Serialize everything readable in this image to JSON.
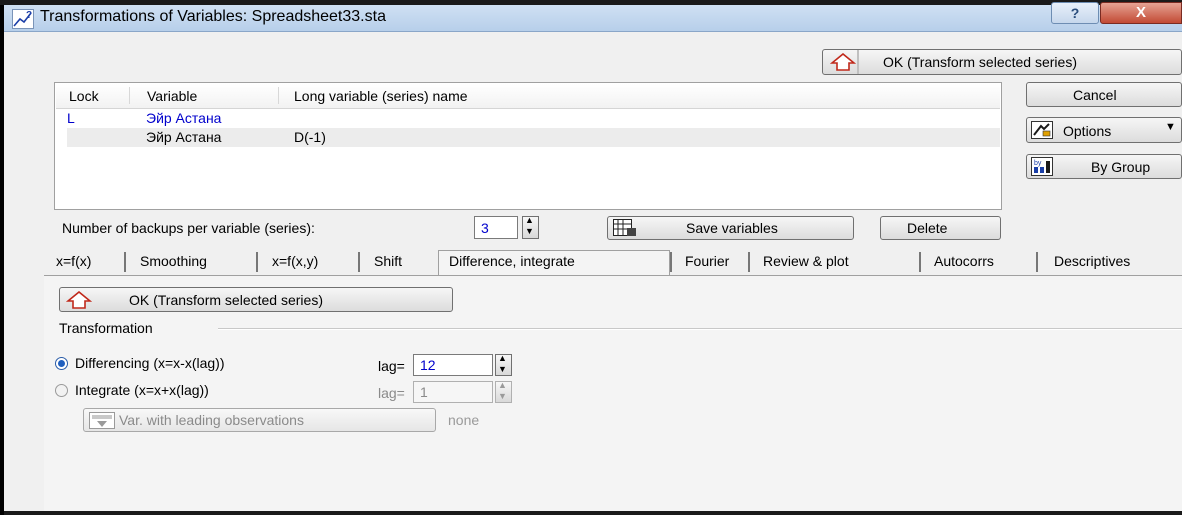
{
  "window": {
    "title": "Transformations of Variables: Spreadsheet33.sta",
    "help_label": "?",
    "close_label": "X"
  },
  "top_ok_label": "OK (Transform selected series)",
  "side_buttons": {
    "cancel": "Cancel",
    "options": "Options",
    "by_group": "By Group"
  },
  "list": {
    "columns": [
      "Lock",
      "Variable",
      "Long variable (series) name"
    ],
    "rows": [
      {
        "lock": "L",
        "variable": "Эйр Астана",
        "long_name": ""
      },
      {
        "lock": "",
        "variable": "Эйр Астана",
        "long_name": "D(-1)"
      }
    ]
  },
  "backups": {
    "label": "Number of backups per variable (series):",
    "value": "3"
  },
  "save_variables_label": "Save variables",
  "delete_label": "Delete",
  "tabs": [
    "x=f(x)",
    "Smoothing",
    "x=f(x,y)",
    "Shift",
    "Difference, integrate",
    "Fourier",
    "Review & plot",
    "Autocorrs",
    "Descriptives"
  ],
  "active_tab": "Difference, integrate",
  "panel": {
    "ok_label": "OK (Transform selected series)",
    "group_label": "Transformation",
    "differencing_label": "Differencing (x=x-x(lag))",
    "differencing_lag_label": "lag=",
    "differencing_lag_value": "12",
    "integrate_label": "Integrate (x=x+x(lag))",
    "integrate_lag_label": "lag=",
    "integrate_lag_value": "1",
    "leading_obs_label": "Var. with leading observations",
    "leading_obs_value": "none"
  },
  "colors": {
    "accent_blue": "#0000cc",
    "selected_radio": "#1f5fbf"
  }
}
